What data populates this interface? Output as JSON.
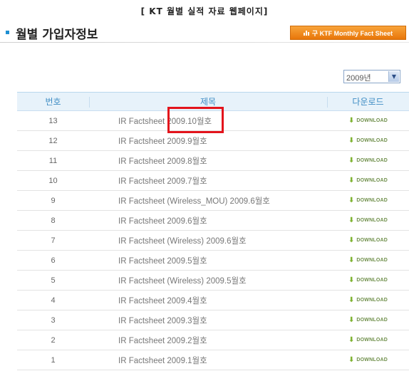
{
  "caption": "[ KT 월별 실적 자료 웹페이지]",
  "page_title": "월별 가입자정보",
  "ktf_button_label": "구 KTF Monthly Fact Sheet",
  "year_select": {
    "value": "2009년"
  },
  "table": {
    "headers": {
      "no": "번호",
      "title": "제목",
      "download": "다운로드"
    },
    "download_label": "DOWNLOAD",
    "rows": [
      {
        "no": "13",
        "title": "IR Factsheet 2009.10월호"
      },
      {
        "no": "12",
        "title": "IR Factsheet 2009.9월호"
      },
      {
        "no": "11",
        "title": "IR Factsheet 2009.8월호"
      },
      {
        "no": "10",
        "title": "IR Factsheet 2009.7월호"
      },
      {
        "no": "9",
        "title": "IR Factsheet (Wireless_MOU) 2009.6월호"
      },
      {
        "no": "8",
        "title": "IR Factsheet 2009.6월호"
      },
      {
        "no": "7",
        "title": "IR Factsheet (Wireless) 2009.6월호"
      },
      {
        "no": "6",
        "title": "IR Factsheet 2009.5월호"
      },
      {
        "no": "5",
        "title": "IR Factsheet (Wireless) 2009.5월호"
      },
      {
        "no": "4",
        "title": "IR Factsheet 2009.4월호"
      },
      {
        "no": "3",
        "title": "IR Factsheet 2009.3월호"
      },
      {
        "no": "2",
        "title": "IR Factsheet 2009.2월호"
      },
      {
        "no": "1",
        "title": "IR Factsheet 2009.1월호"
      }
    ]
  },
  "colors": {
    "accent_orange": "#f08a1c",
    "header_blue": "#3f8dc4",
    "highlight_red": "#e3141c",
    "download_green": "#7fb332"
  }
}
